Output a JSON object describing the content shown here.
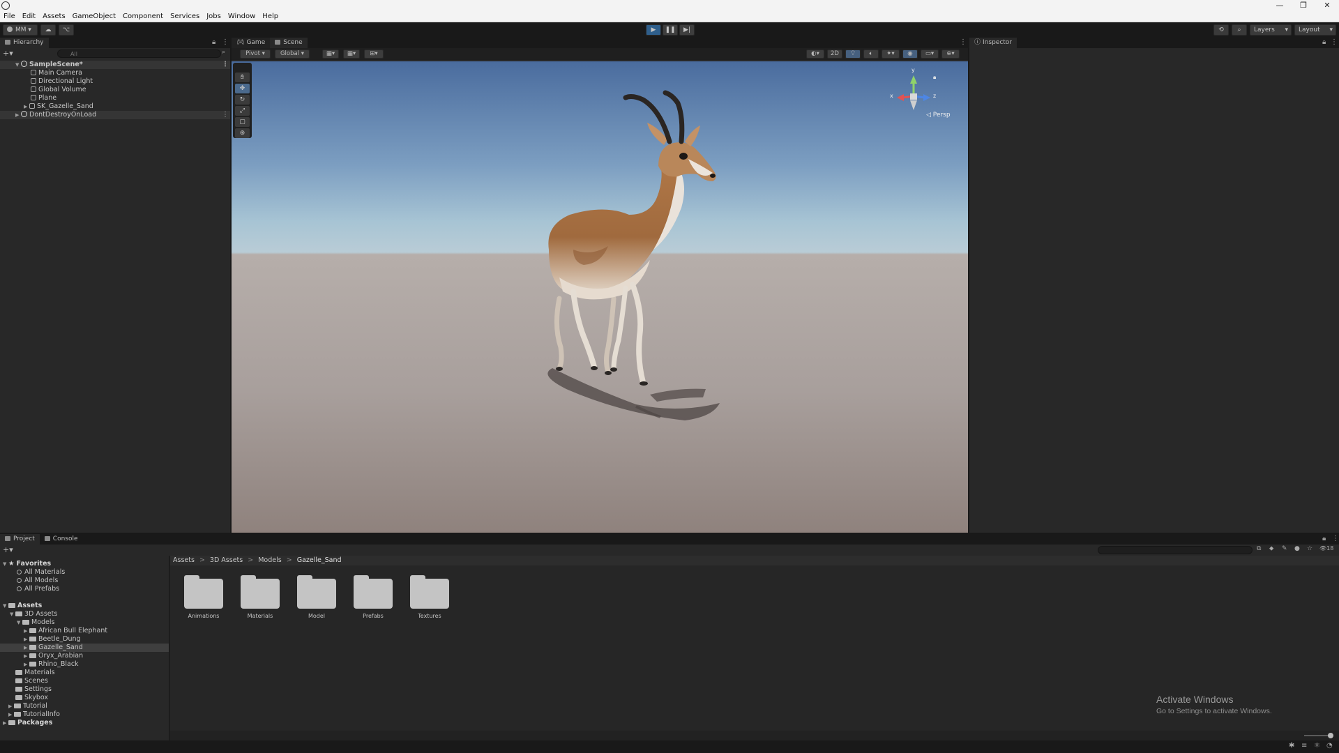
{
  "window": {
    "minimize": "—",
    "maximize": "❐",
    "close": "✕"
  },
  "menu": [
    "File",
    "Edit",
    "Assets",
    "GameObject",
    "Component",
    "Services",
    "Jobs",
    "Window",
    "Help"
  ],
  "toolbar": {
    "account": "MM",
    "layers": "Layers",
    "layout": "Layout",
    "play": "▶",
    "pause": "❚❚",
    "step": "▶|"
  },
  "hierarchy": {
    "tab": "Hierarchy",
    "search_placeholder": "All",
    "scene": "SampleScene*",
    "items": [
      "Main Camera",
      "Directional Light",
      "Global Volume",
      "Plane",
      "SK_Gazelle_Sand"
    ],
    "dont_destroy": "DontDestroyOnLoad"
  },
  "center_tabs": {
    "game": "Game",
    "scene": "Scene"
  },
  "scene_toolbar": {
    "pivot": "Pivot",
    "global": "Global",
    "mode_2d": "2D"
  },
  "gizmo": {
    "x": "x",
    "y": "y",
    "z": "z",
    "persp": "◁ Persp"
  },
  "inspector": {
    "tab": "Inspector"
  },
  "bottom_tabs": {
    "project": "Project",
    "console": "Console"
  },
  "project": {
    "favorites_title": "Favorites",
    "favorites": [
      "All Materials",
      "All Models",
      "All Prefabs"
    ],
    "assets_title": "Assets",
    "tree": {
      "assets3d": "3D Assets",
      "models": "Models",
      "model_items": [
        "African Bull Elephant",
        "Beetle_Dung",
        "Gazelle_Sand",
        "Oryx_Arabian",
        "Rhino_Black"
      ],
      "other": [
        "Materials",
        "Scenes",
        "Settings",
        "Skybox",
        "Tutorial",
        "TutorialInfo"
      ]
    },
    "packages": "Packages",
    "breadcrumb": [
      "Assets",
      "3D Assets",
      "Models",
      "Gazelle_Sand"
    ],
    "folders": [
      "Animations",
      "Materials",
      "Model",
      "Prefabs",
      "Textures"
    ],
    "count_badge": "18"
  },
  "watermark": {
    "line1": "Activate Windows",
    "line2": "Go to Settings to activate Windows."
  }
}
